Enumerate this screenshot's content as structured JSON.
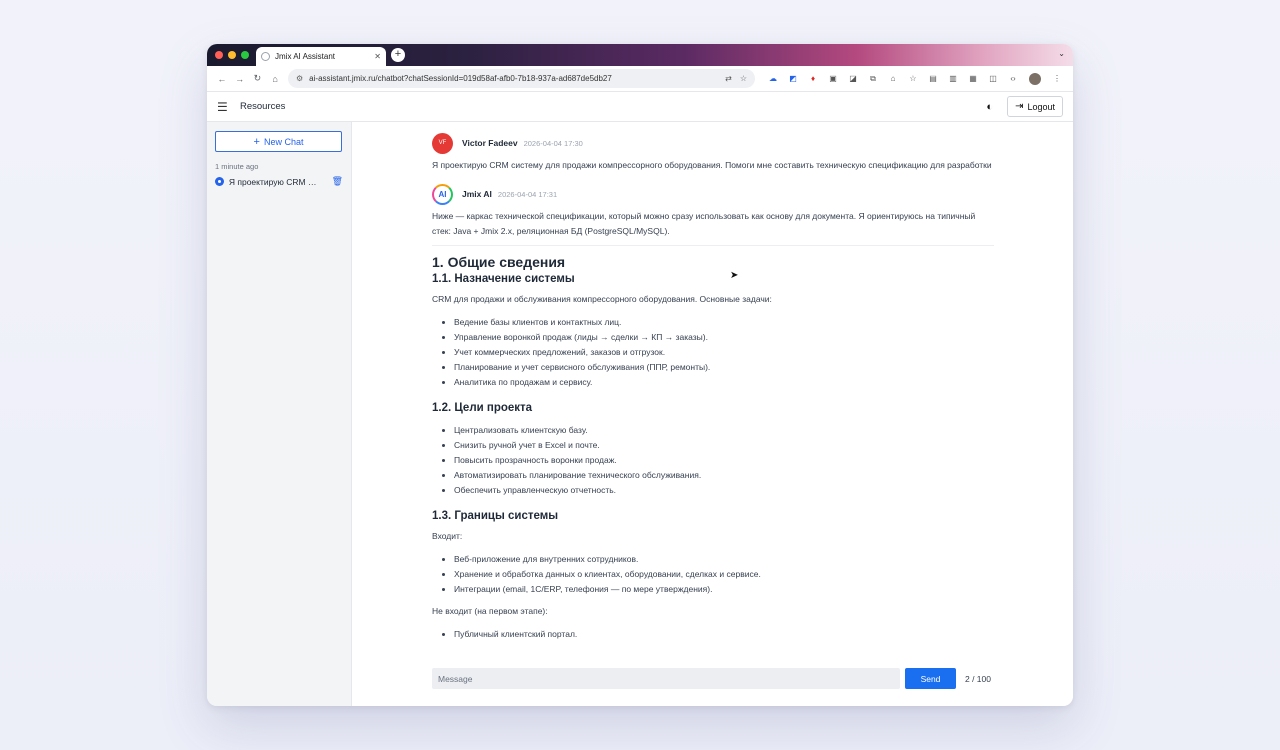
{
  "browser": {
    "tab_title": "Jmix AI Assistant",
    "url": "ai-assistant.jmix.ru/chatbot?chatSessionId=019d58af-afb0-7b18-937a-ad687de5db27"
  },
  "header": {
    "title": "Resources",
    "logout_label": "Logout"
  },
  "sidebar": {
    "new_chat_label": "New Chat",
    "group_label": "1 minute ago",
    "items": [
      {
        "title": "Я проектирую CRM систему для продажи компрессорного оборудования"
      }
    ]
  },
  "chat": {
    "user_message": {
      "avatar_initials": "VF",
      "author": "Victor Fadeev",
      "time": "2026-04-04 17:30",
      "text": "Я проектирую CRM систему для продажи компрессорного оборудования. Помоги мне составить техническую спецификацию для разработки"
    },
    "ai_message": {
      "avatar_text": "AI",
      "author": "Jmix AI",
      "time": "2026-04-04 17:31",
      "intro": "Ниже — каркас технической спецификации, который можно сразу использовать как основу для документа. Я ориентируюсь на типичный стек: Java + Jmix 2.x, реляционная БД (PostgreSQL/MySQL).",
      "h1": "1. Общие сведения",
      "s1_title": "1.1. Назначение системы",
      "s1_para": "CRM для продажи и обслуживания компрессорного оборудования. Основные задачи:",
      "s1_items": [
        "Ведение базы клиентов и контактных лиц.",
        "Управление воронкой продаж (лиды → сделки → КП → заказы).",
        "Учет коммерческих предложений, заказов и отгрузок.",
        "Планирование и учет сервисного обслуживания (ППР, ремонты).",
        "Аналитика по продажам и сервису."
      ],
      "s2_title": "1.2. Цели проекта",
      "s2_items": [
        "Централизовать клиентскую базу.",
        "Снизить ручной учет в Excel и почте.",
        "Повысить прозрачность воронки продаж.",
        "Автоматизировать планирование технического обслуживания.",
        "Обеспечить управленческую отчетность."
      ],
      "s3_title": "1.3. Границы системы",
      "s3_in_label": "Входит:",
      "s3_in_items": [
        "Веб-приложение для внутренних сотрудников.",
        "Хранение и обработка данных о клиентах, оборудовании, сделках и сервисе.",
        "Интеграции (email, 1С/ERP, телефония — по мере утверждения)."
      ],
      "s3_out_label": "Не входит (на первом этапе):",
      "s3_out_items": [
        "Публичный клиентский портал."
      ]
    }
  },
  "composer": {
    "placeholder": "Message",
    "send_label": "Send",
    "counter": "2 / 100"
  }
}
